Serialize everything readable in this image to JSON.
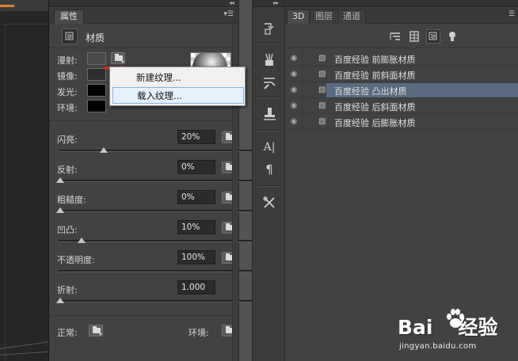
{
  "properties_panel": {
    "tab": "属性",
    "header_title": "材质",
    "material_rows": [
      {
        "label": "漫射:",
        "swatch_color": "#4a4a4a"
      },
      {
        "label": "镜像:",
        "swatch_color": "#2d2d2d"
      },
      {
        "label": "发光:",
        "swatch_color": "#000000"
      },
      {
        "label": "环境:",
        "swatch_color": "#000000"
      }
    ],
    "texture_menu": {
      "items": [
        "新建纹理...",
        "载入纹理..."
      ],
      "highlighted_index": 1
    },
    "sliders": [
      {
        "label": "闪亮:",
        "value": "20%",
        "level": 0.2
      },
      {
        "label": "反射:",
        "value": "0%",
        "level": 0.0
      },
      {
        "label": "粗糙度:",
        "value": "0%",
        "level": 0.0
      },
      {
        "label": "凹凸:",
        "value": "10%",
        "level": 0.1
      },
      {
        "label": "不透明度:",
        "value": "100%",
        "level": 1.0
      },
      {
        "label": "折射:",
        "value": "1.000",
        "level": 0.0
      }
    ],
    "bottom": {
      "normal_label": "正常:",
      "env_label": "环境:"
    }
  },
  "panel_3d": {
    "tabs": [
      "3D",
      "图层",
      "通道"
    ],
    "active_tab": 0,
    "layers": [
      {
        "name": "百度经验 前膨胀材质",
        "selected": false
      },
      {
        "name": "百度经验 前斜面材质",
        "selected": false
      },
      {
        "name": "百度经验 凸出材质",
        "selected": true
      },
      {
        "name": "百度经验 后斜面材质",
        "selected": false
      },
      {
        "name": "百度经验 后膨胀材质",
        "selected": false
      }
    ]
  },
  "watermark": {
    "logo_left": "Bai",
    "logo_right": "经验",
    "url": "jingyan.baidu.com"
  },
  "icons": {
    "tools": [
      "3d-rotate-icon",
      "brush-presets-icon",
      "brush-icon",
      "clone-source-icon",
      "character-icon",
      "paragraph-icon",
      "tools-icon"
    ],
    "toolbar_3d": [
      "scene-icon",
      "mesh-icon",
      "material-icon",
      "light-icon"
    ]
  },
  "colors": {
    "accent_red": "#e0261c",
    "selection_blue": "#5a6a80",
    "panel_bg": "#424242"
  }
}
